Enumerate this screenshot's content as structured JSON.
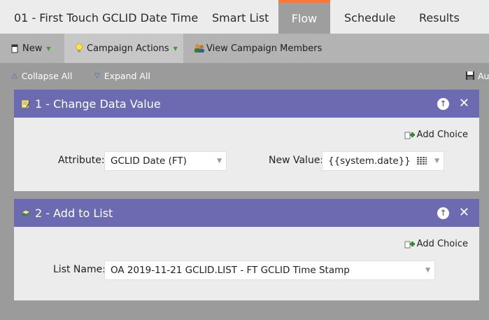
{
  "tabs": [
    {
      "label": "01 - First Touch GCLID Date Time",
      "active": false
    },
    {
      "label": "Smart List",
      "active": false
    },
    {
      "label": "Flow",
      "active": true
    },
    {
      "label": "Schedule",
      "active": false
    },
    {
      "label": "Results",
      "active": false
    }
  ],
  "toolbar": {
    "new_label": "New",
    "campaign_actions_label": "Campaign Actions",
    "view_members_label": "View Campaign Members"
  },
  "subrow": {
    "collapse_all": "Collapse All",
    "expand_all": "Expand All",
    "auto_save": "Au"
  },
  "flow_steps": [
    {
      "title": "1 - Change Data Value",
      "add_choice": "Add Choice",
      "attribute_label": "Attribute:",
      "attribute_value": "GCLID Date (FT)",
      "new_value_label": "New Value:",
      "new_value": "{{system.date}}"
    },
    {
      "title": "2 - Add to List",
      "add_choice": "Add Choice",
      "list_name_label": "List Name:",
      "list_name_value": "OA 2019-11-21 GCLID.LIST - FT GCLID Time Stamp"
    }
  ],
  "colors": {
    "panel_header": "#6c6ab0",
    "active_tab_accent": "#ff7733",
    "background": "#9b9b9b"
  }
}
